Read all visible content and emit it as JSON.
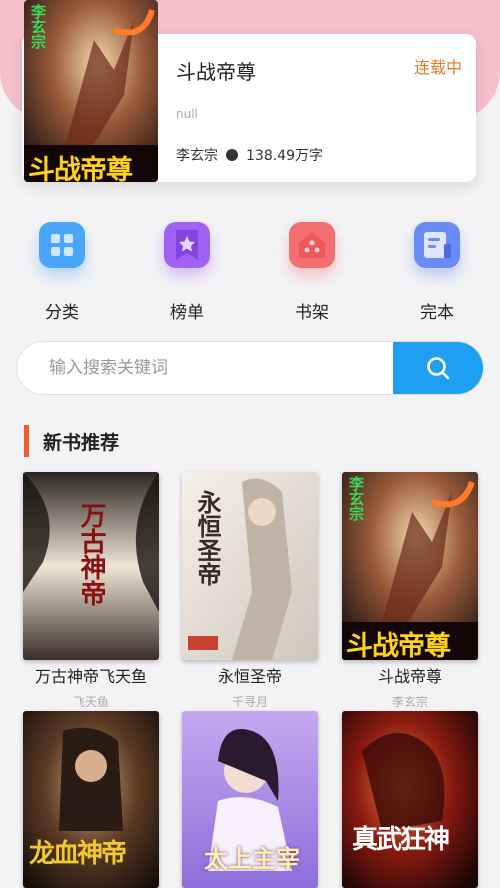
{
  "hero": {
    "title": "斗战帝尊",
    "status": "连载中",
    "intro": "null",
    "author": "李玄宗",
    "word_count": "138.49万字",
    "cover_text_top": "李玄宗",
    "cover_text_bottom": "斗战帝尊"
  },
  "menu": [
    {
      "label": "分类",
      "icon": "grid-icon",
      "color": "#3d9cf7"
    },
    {
      "label": "榜单",
      "icon": "star-bookmark-icon",
      "color": "#9a5cf0"
    },
    {
      "label": "书架",
      "icon": "house-icon",
      "color": "#f06a6a"
    },
    {
      "label": "完本",
      "icon": "book-list-icon",
      "color": "#5a7ef2"
    }
  ],
  "search": {
    "placeholder": "输入搜索关键词",
    "value": ""
  },
  "section": {
    "title": "新书推荐"
  },
  "books": [
    {
      "name": "万古神帝飞天鱼",
      "author": "飞天鱼",
      "cover_text": "万古神帝"
    },
    {
      "name": "永恒圣帝",
      "author": "千寻月",
      "cover_text": "永恒圣帝"
    },
    {
      "name": "斗战帝尊",
      "author": "李玄宗",
      "cover_text": "斗战帝尊"
    },
    {
      "name": "",
      "author": "",
      "cover_text": "龙血神帝"
    },
    {
      "name": "",
      "author": "",
      "cover_text": "太上主宰"
    },
    {
      "name": "",
      "author": "",
      "cover_text": "真武狂神"
    }
  ],
  "colors": {
    "accent": "#1e9ff2",
    "status": "#e07a2c",
    "section_bar": "#ee5a2c",
    "header_bg": "#f7bfcd"
  }
}
